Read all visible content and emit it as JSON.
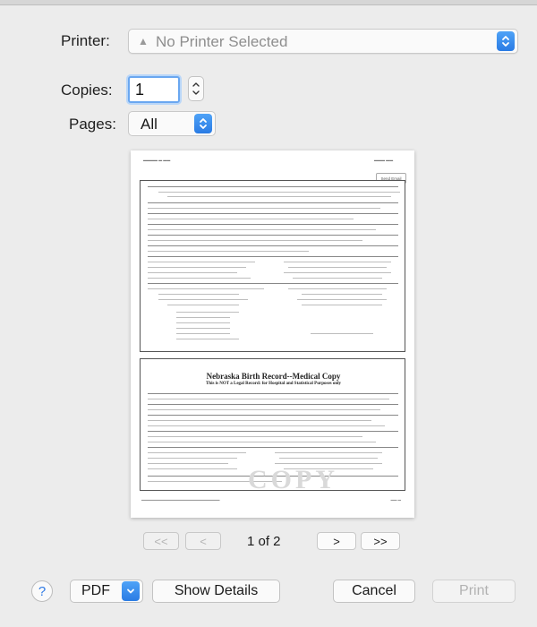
{
  "printer": {
    "label": "Printer:",
    "value": "No Printer Selected",
    "warning_icon": "warning-triangle-icon"
  },
  "copies": {
    "label": "Copies:",
    "value": "1"
  },
  "pages": {
    "label": "Pages:",
    "value": "All"
  },
  "preview": {
    "send_email_label": "Send Email",
    "page2_title": "Nebraska Birth Record--Medical Copy",
    "page2_subtitle": "This is NOT a Legal Record: for Hospital and Statistical Purposes only",
    "watermark": "COPY"
  },
  "pager": {
    "first": "<<",
    "prev": "<",
    "next": ">",
    "last": ">>",
    "page_indicator": "1 of 2"
  },
  "bottom": {
    "help": "?",
    "pdf": "PDF",
    "show_details": "Show Details",
    "cancel": "Cancel",
    "print": "Print"
  },
  "colors": {
    "accent": "#2a7be4",
    "background": "#ececec"
  }
}
